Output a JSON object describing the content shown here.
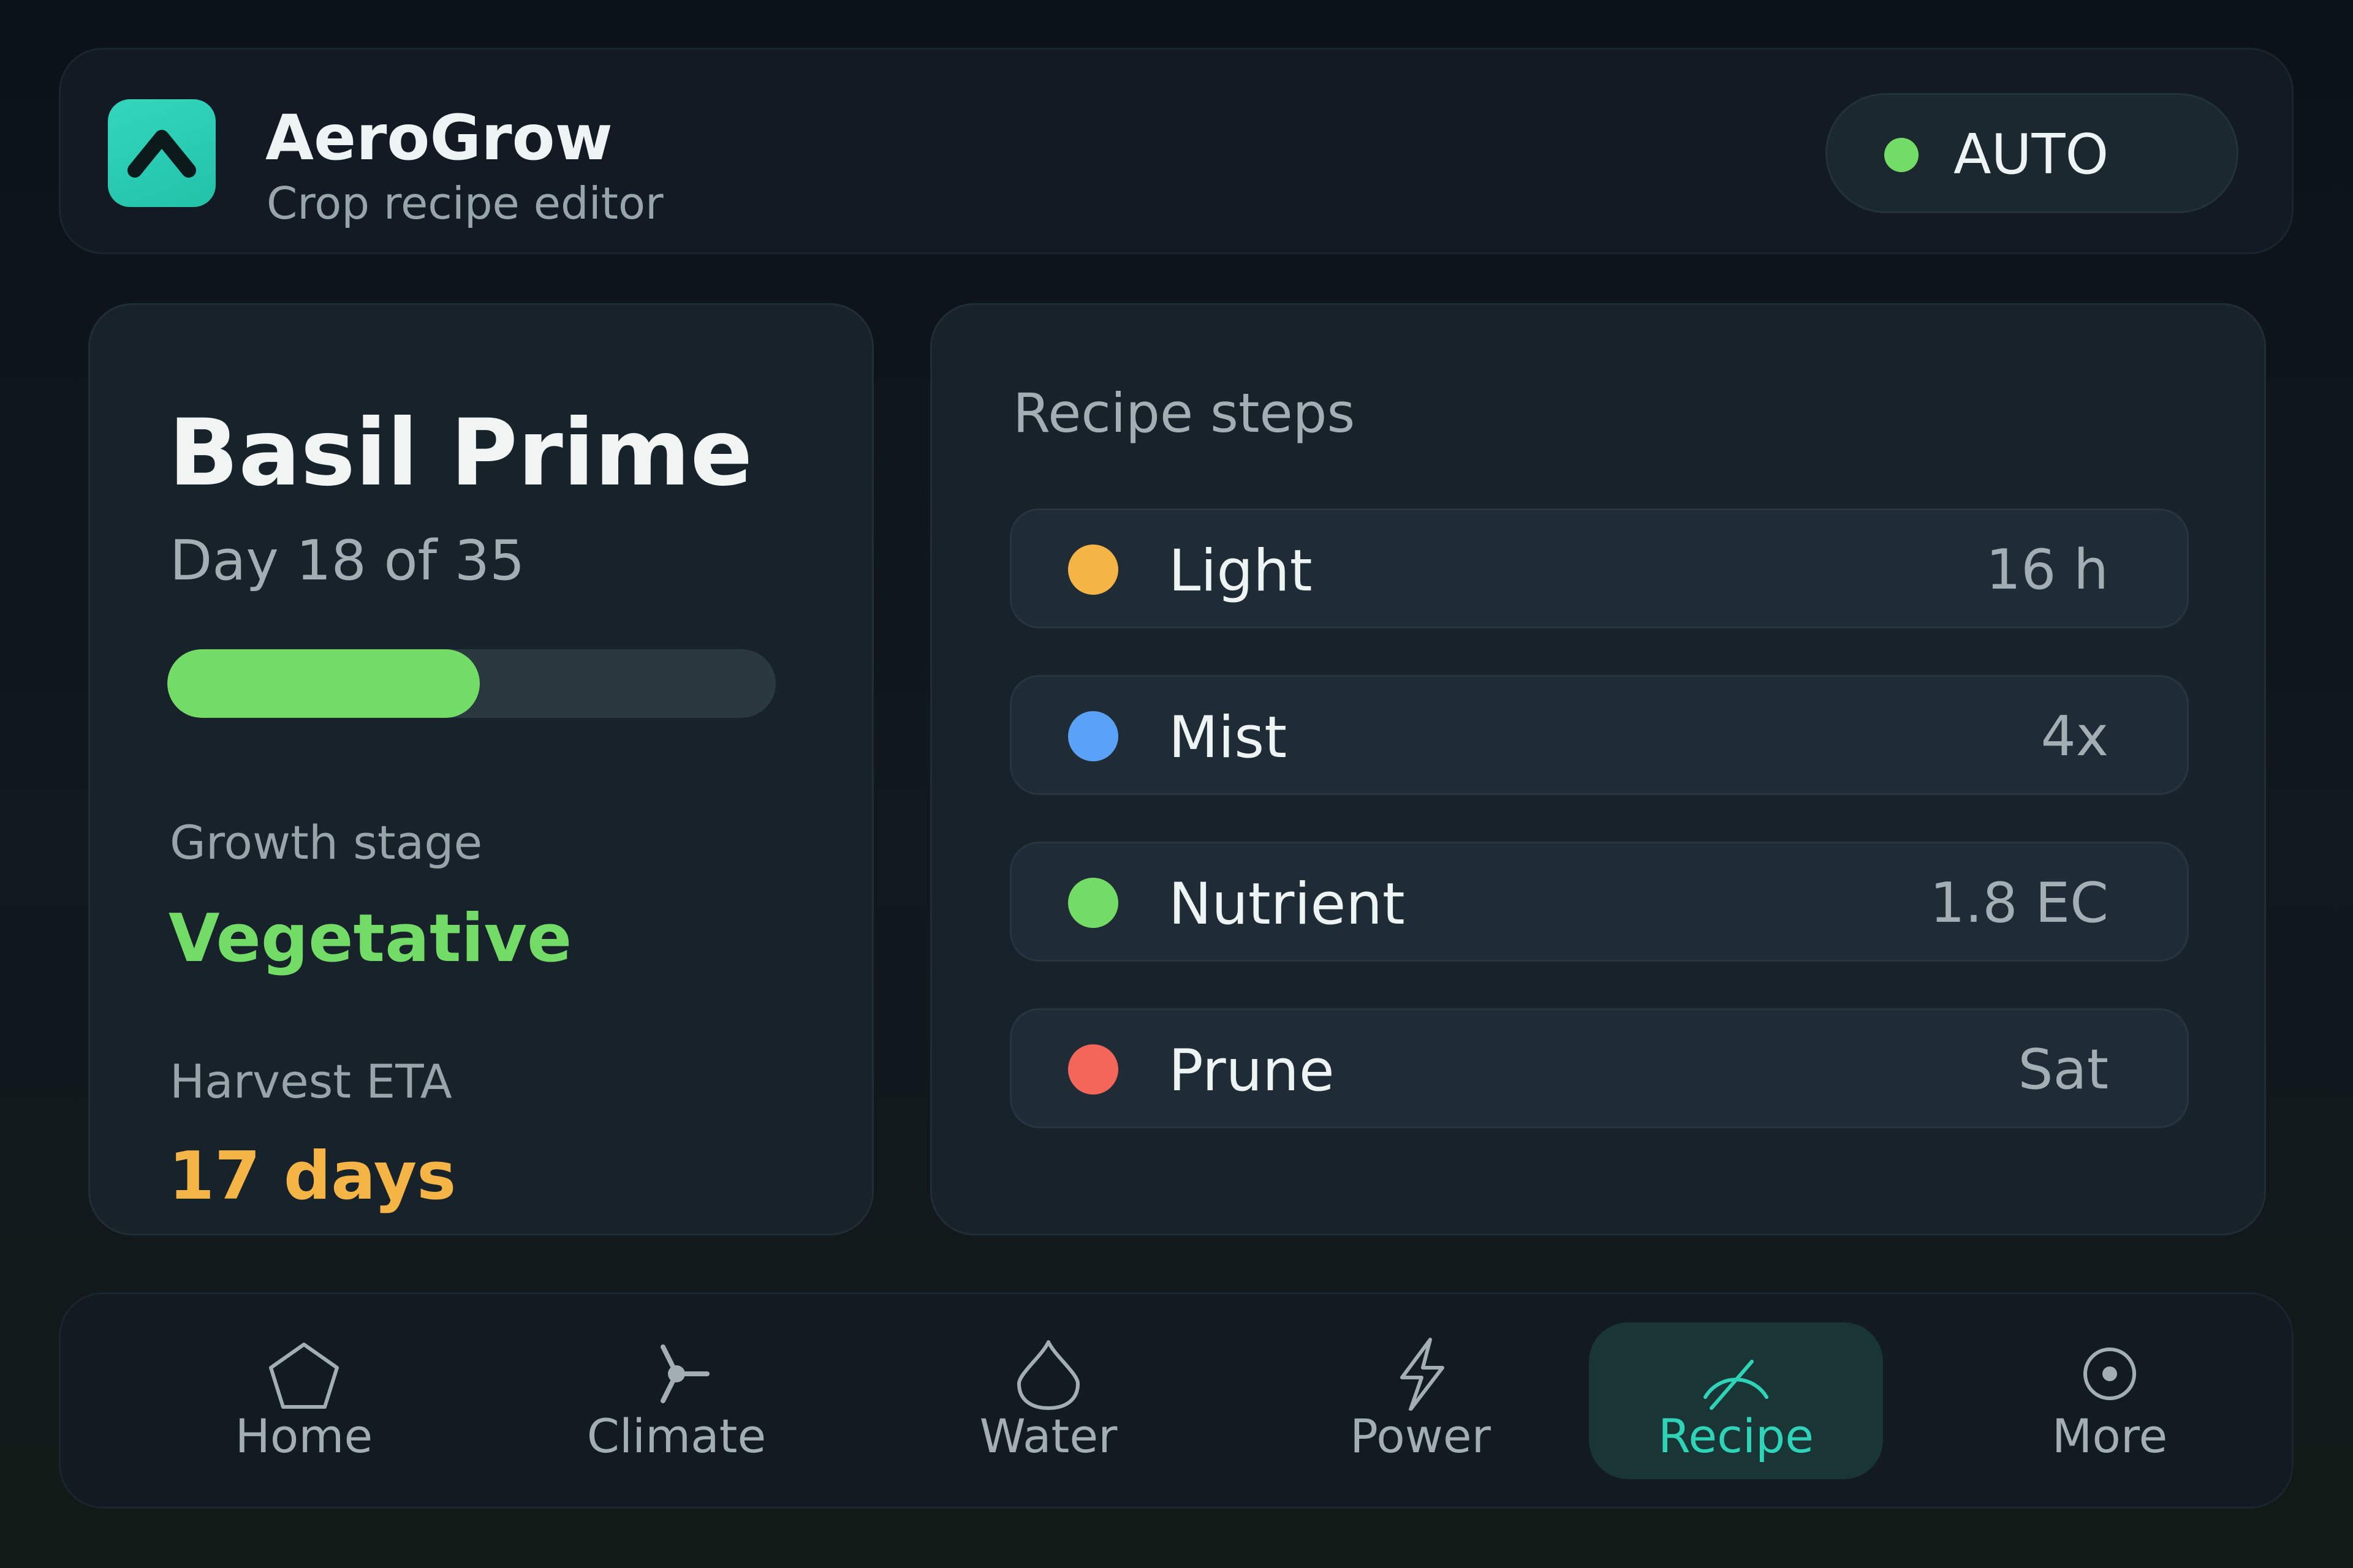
{
  "app": {
    "name": "AeroGrow",
    "subtitle": "Crop recipe editor",
    "logo_icon": "chevron-up-icon"
  },
  "mode": {
    "label": "AUTO",
    "dot_color": "#73dc66"
  },
  "crop": {
    "name": "Basil Prime",
    "day_text": "Day 18 of 35",
    "progress_fraction": 0.514,
    "stage_label": "Growth stage",
    "stage_value": "Vegetative",
    "stage_color": "#73dc66",
    "eta_label": "Harvest ETA",
    "eta_value": "17 days",
    "eta_color": "#f5b446"
  },
  "recipe": {
    "title": "Recipe steps",
    "steps": [
      {
        "label": "Light",
        "value": "16 h",
        "color": "#f5b446"
      },
      {
        "label": "Mist",
        "value": "4x",
        "color": "#5aa2f7"
      },
      {
        "label": "Nutrient",
        "value": "1.8 EC",
        "color": "#73dc66"
      },
      {
        "label": "Prune",
        "value": "Sat",
        "color": "#f5665a"
      }
    ]
  },
  "nav": {
    "active": "Recipe",
    "items": [
      {
        "label": "Home",
        "icon": "home-icon"
      },
      {
        "label": "Climate",
        "icon": "fan-icon"
      },
      {
        "label": "Water",
        "icon": "droplet-icon"
      },
      {
        "label": "Power",
        "icon": "lightning-icon"
      },
      {
        "label": "Recipe",
        "icon": "gauge-icon"
      },
      {
        "label": "More",
        "icon": "more-circle-icon"
      }
    ]
  }
}
